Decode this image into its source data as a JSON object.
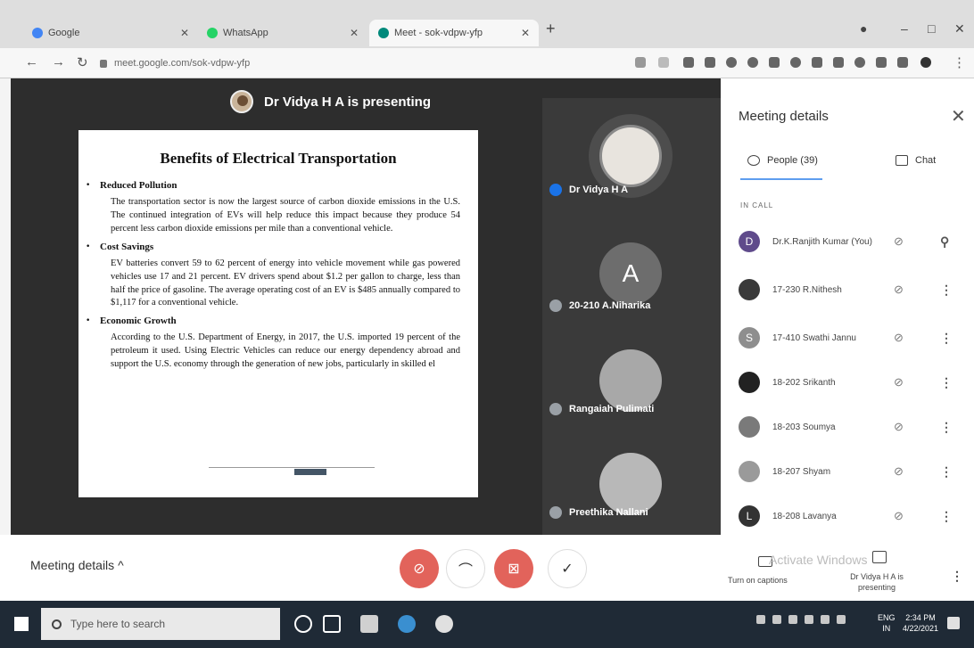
{
  "browser": {
    "tabs": [
      {
        "title": "Google",
        "favicon_color": "#4285f4"
      },
      {
        "title": "WhatsApp",
        "favicon_color": "#25d366"
      },
      {
        "title": "Meet - sok-vdpw-yfp",
        "favicon_color": "#00897b"
      }
    ],
    "url": "meet.google.com/sok-vdpw-yfp"
  },
  "stage": {
    "presenting_banner": "Dr Vidya H A is presenting"
  },
  "slide": {
    "title": "Benefits of Electrical Transportation",
    "sections": [
      {
        "heading": "Reduced Pollution",
        "body": "The transportation sector is now the largest source of carbon dioxide emissions in the U.S. The continued integration of EVs will help reduce this impact because they produce 54 percent less carbon dioxide emissions per mile than a conventional vehicle."
      },
      {
        "heading": "Cost Savings",
        "body": "EV batteries convert 59 to 62 percent of energy into vehicle movement while gas powered vehicles use 17 and 21 percent. EV drivers spend about $1.2 per gallon to charge, less than half the price of gasoline. The average operating cost of an EV is $485 annually compared to $1,117 for a conventional vehicle."
      },
      {
        "heading": "Economic Growth",
        "body": "According to the U.S. Department of Energy, in 2017, the U.S. imported 19 percent of the petroleum it used. Using Electric Vehicles can reduce our energy dependency abroad and support the U.S. economy through the generation of new jobs, particularly in skilled el"
      }
    ]
  },
  "tiles": [
    {
      "name": "Dr Vidya H A"
    },
    {
      "name": "20-210 A.Niharika",
      "initial": "A"
    },
    {
      "name": "Rangaiah Pulimati"
    },
    {
      "name": "Preethika Nallani"
    }
  ],
  "side_panel": {
    "title": "Meeting details",
    "tab_people": "People (39)",
    "tab_chat": "Chat",
    "section_label": "IN CALL",
    "participants": [
      {
        "initial": "D",
        "name": "Dr.K.Ranjith Kumar (You)",
        "color": "#5f4b8b"
      },
      {
        "initial": "",
        "name": "17-230 R.Nithesh",
        "color": "#3a3a3a"
      },
      {
        "initial": "S",
        "name": "17-410 Swathi Jannu",
        "color": "#8e8e8e"
      },
      {
        "initial": "",
        "name": "18-202 Srikanth",
        "color": "#222222"
      },
      {
        "initial": "",
        "name": "18-203 Soumya",
        "color": "#7a7a7a"
      },
      {
        "initial": "",
        "name": "18-207 Shyam",
        "color": "#9a9a9a"
      },
      {
        "initial": "L",
        "name": "18-208 Lavanya",
        "color": "#333333"
      }
    ]
  },
  "controls": {
    "meeting_details_label": "Meeting details",
    "captions_label": "Turn on captions",
    "watermark": "Activate Windows",
    "presenting_label": "Dr Vidya H A is presenting"
  },
  "taskbar": {
    "search_placeholder": "Type here to search",
    "lang_top": "ENG",
    "lang_bottom": "IN",
    "time": "2:34 PM",
    "date": "4/22/2021"
  }
}
